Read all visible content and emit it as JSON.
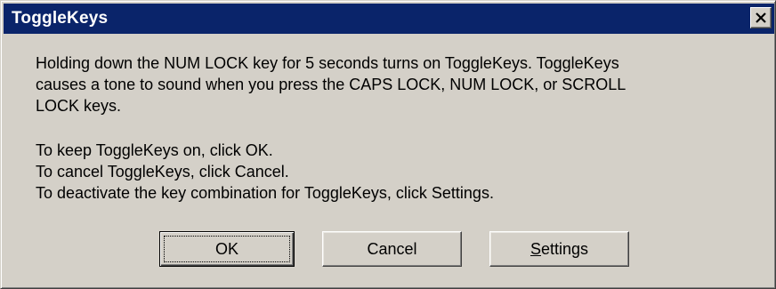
{
  "window": {
    "title": "ToggleKeys",
    "close_icon": "close-icon"
  },
  "message": {
    "line1": "Holding down the NUM LOCK key for 5 seconds turns on ToggleKeys.  ToggleKeys",
    "line2": "causes a tone to sound when you press the CAPS LOCK, NUM LOCK, or SCROLL",
    "line3": "LOCK keys.",
    "line4": "To keep ToggleKeys on, click OK.",
    "line5": "To cancel ToggleKeys, click Cancel.",
    "line6": "To deactivate the key combination for ToggleKeys, click Settings."
  },
  "buttons": {
    "ok_label": "OK",
    "cancel_label": "Cancel",
    "settings_accel": "S",
    "settings_rest": "ettings",
    "default_button": "OK"
  },
  "colors": {
    "titlebar": "#0a246a",
    "face": "#d4d0c8",
    "title_text": "#ffffff"
  }
}
